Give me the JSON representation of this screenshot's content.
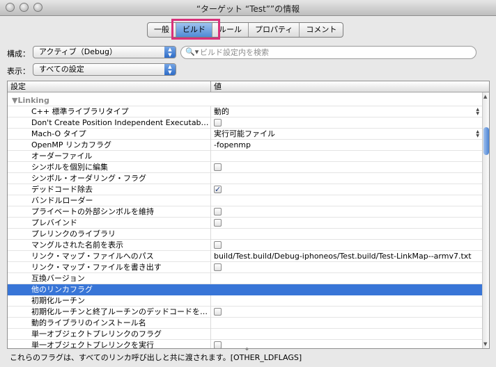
{
  "window": {
    "title": "“ターゲット “Test””の情報"
  },
  "tabs": [
    {
      "label": "一般",
      "active": false
    },
    {
      "label": "ビルド",
      "active": true
    },
    {
      "label": "ルール",
      "active": false
    },
    {
      "label": "プロパティ",
      "active": false
    },
    {
      "label": "コメント",
      "active": false
    }
  ],
  "config": {
    "label": "構成：",
    "value": "アクティブ（Debug）"
  },
  "show": {
    "label": "表示：",
    "value": "すべての設定"
  },
  "search": {
    "placeholder": "ビルド設定内を検索"
  },
  "table": {
    "headers": {
      "setting": "設定",
      "value": "値"
    },
    "section": "▼Linking",
    "rows": [
      {
        "name": "C++ 標準ライブラリタイプ",
        "value": "動的",
        "stepper": true
      },
      {
        "name": "Don't Create Position Independent Executables",
        "checkbox": false
      },
      {
        "name": "Mach-O タイプ",
        "value": "実行可能ファイル",
        "stepper": true
      },
      {
        "name": "OpenMP リンカフラグ",
        "value": "-fopenmp"
      },
      {
        "name": "オーダーファイル",
        "value": ""
      },
      {
        "name": "シンボルを個別に編集",
        "checkbox": false
      },
      {
        "name": "シンボル・オーダリング・フラグ",
        "value": ""
      },
      {
        "name": "デッドコード除去",
        "checkbox": true
      },
      {
        "name": "バンドルローダー",
        "value": ""
      },
      {
        "name": "プライベートの外部シンボルを維持",
        "checkbox": false
      },
      {
        "name": "プレバインド",
        "checkbox": false
      },
      {
        "name": "プレリンクのライブラリ",
        "value": ""
      },
      {
        "name": "マングルされた名前を表示",
        "checkbox": false
      },
      {
        "name": "リンク・マップ・ファイルへのパス",
        "value": "build/Test.build/Debug-iphoneos/Test.build/Test-LinkMap--armv7.txt"
      },
      {
        "name": "リンク・マップ・ファイルを書き出す",
        "checkbox": false
      },
      {
        "name": "互換バージョン",
        "value": ""
      },
      {
        "name": "他のリンカフラグ",
        "value": "",
        "selected": true
      },
      {
        "name": "初期化ルーチン",
        "value": ""
      },
      {
        "name": "初期化ルーチンと終了ルーチンのデッドコードを…",
        "checkbox": false
      },
      {
        "name": "動的ライブラリのインストール名",
        "value": ""
      },
      {
        "name": "単一オブジェクトプレリンクのフラグ",
        "value": ""
      },
      {
        "name": "単一オブジェクトプレリンクを実行",
        "checkbox": false
      }
    ]
  },
  "description": "これらのフラグは、すべてのリンカ呼び出しと共に渡されます。[OTHER_LDFLAGS]"
}
